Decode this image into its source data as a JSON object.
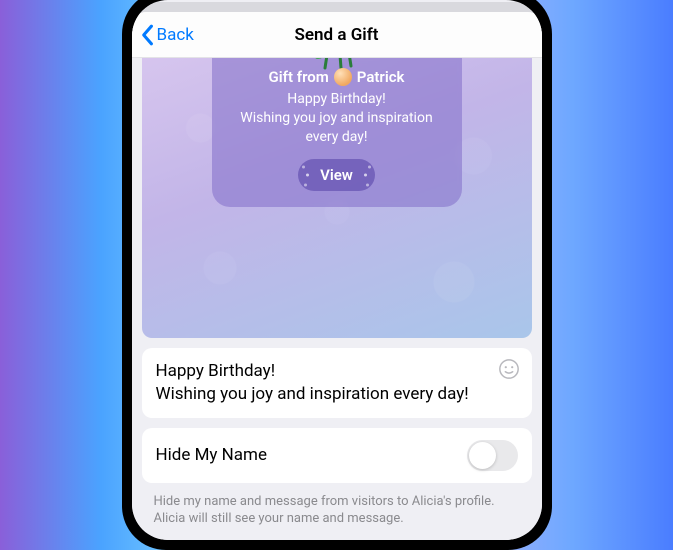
{
  "nav": {
    "back": "Back",
    "title": "Send a Gift"
  },
  "preview": {
    "from_prefix": "Gift from",
    "sender": "Patrick",
    "line1": "Happy Birthday!",
    "line2": "Wishing you joy and inspiration every day!",
    "view": "View"
  },
  "message": {
    "value": "Happy Birthday!\nWishing you joy and inspiration every day!"
  },
  "hide": {
    "label": "Hide My Name",
    "description": "Hide my name and message from visitors to Alicia's profile. Alicia will still see your name and message."
  }
}
